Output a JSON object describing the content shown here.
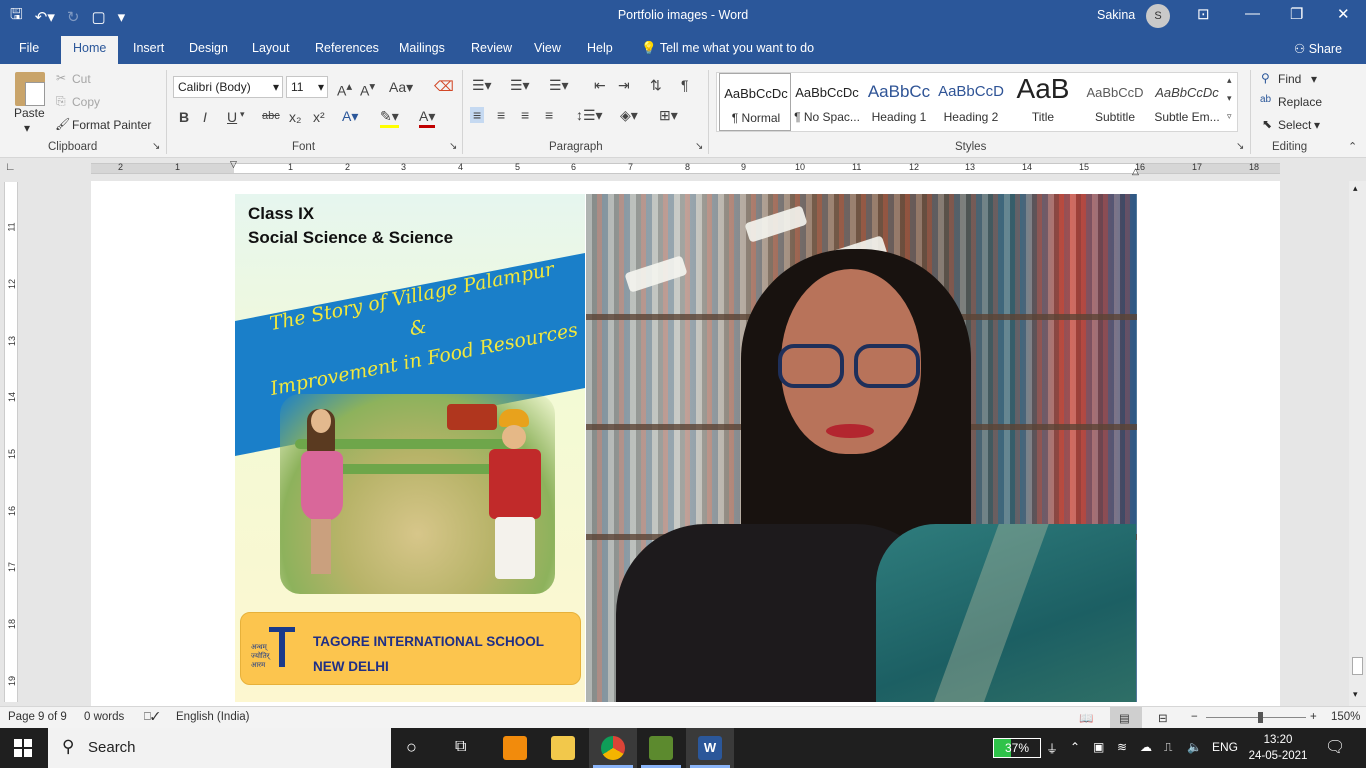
{
  "app": {
    "title": "Portfolio images  -  Word",
    "user": "Sakina",
    "user_initial": "S"
  },
  "tabs": [
    "File",
    "Home",
    "Insert",
    "Design",
    "Layout",
    "References",
    "Mailings",
    "Review",
    "View",
    "Help"
  ],
  "tell_me": "Tell me what you want to do",
  "share": "Share",
  "clipboard": {
    "paste": "Paste",
    "cut": "Cut",
    "copy": "Copy",
    "format_painter": "Format Painter",
    "label": "Clipboard"
  },
  "font": {
    "name": "Calibri (Body)",
    "size": "11",
    "label": "Font"
  },
  "paragraph": {
    "label": "Paragraph"
  },
  "styles": {
    "label": "Styles",
    "items": [
      {
        "sample": "AaBbCcDc",
        "name": "¶ Normal"
      },
      {
        "sample": "AaBbCcDc",
        "name": "¶ No Spac..."
      },
      {
        "sample": "AaBbCc",
        "name": "Heading 1"
      },
      {
        "sample": "AaBbCcD",
        "name": "Heading 2"
      },
      {
        "sample": "AaB",
        "name": "Title"
      },
      {
        "sample": "AaBbCcD",
        "name": "Subtitle"
      },
      {
        "sample": "AaBbCcDc",
        "name": "Subtle Em..."
      }
    ]
  },
  "editing": {
    "find": "Find",
    "replace": "Replace",
    "select": "Select",
    "label": "Editing"
  },
  "ruler": {
    "h_numbers": [
      "2",
      "1",
      "1",
      "2",
      "3",
      "4",
      "5",
      "6",
      "7",
      "8",
      "9",
      "10",
      "11",
      "12",
      "13",
      "14",
      "15",
      "16",
      "17",
      "18"
    ],
    "v_numbers": [
      "11",
      "12",
      "13",
      "14",
      "15",
      "16",
      "17",
      "18",
      "19"
    ]
  },
  "poster": {
    "class_line1": "Class IX",
    "class_line2": "Social Science & Science",
    "story_line1": "The Story of Village Palampur",
    "story_amp": "&",
    "story_line2": "Improvement in Food Resources",
    "logo_text": "अन्धम् ज्योतिर् आरम",
    "school_line1": "TAGORE INTERNATIONAL SCHOOL",
    "school_line2": "NEW DELHI"
  },
  "status": {
    "page": "Page 9 of 9",
    "words": "0 words",
    "language": "English (India)",
    "zoom": "150%"
  },
  "taskbar": {
    "search": "Search",
    "battery": "37%",
    "battery_level": 0.37,
    "lang": "ENG",
    "time": "13:20",
    "date": "24-05-2021"
  }
}
